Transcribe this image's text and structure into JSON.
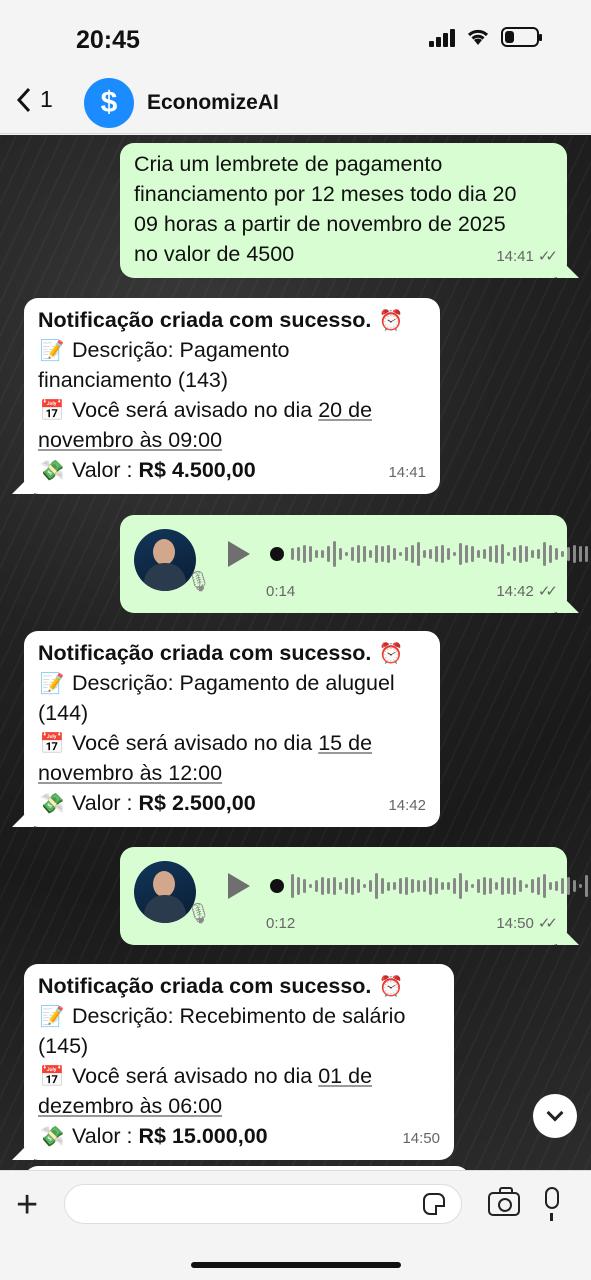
{
  "status_bar": {
    "time": "20:45"
  },
  "header": {
    "back_count": "1",
    "contact_name": "EconomizeAI",
    "avatar_symbol": "$"
  },
  "messages": [
    {
      "type": "outgoing_text",
      "lines": [
        "Cria um lembrete de pagamento",
        "financiamento por 12 meses todo dia 20",
        "09 horas a partir de novembro de 2025",
        "no valor de 4500"
      ],
      "time": "14:41"
    },
    {
      "type": "incoming_notification",
      "title": "Notificação criada com sucesso.",
      "desc_label": "Descrição: ",
      "desc_value": "Pagamento financiamento (143)",
      "date_prefix": "Você será avisado no dia ",
      "date_value": "20 de novembro às 09:00",
      "value_label": "Valor : ",
      "value_amount": "R$ 4.500,00",
      "time": "14:41"
    },
    {
      "type": "outgoing_voice",
      "duration": "0:14",
      "time": "14:42"
    },
    {
      "type": "incoming_notification",
      "title": "Notificação criada com sucesso.",
      "desc_label": "Descrição: ",
      "desc_value": "Pagamento de aluguel (144)",
      "date_prefix": "Você será avisado no dia ",
      "date_value": "15 de novembro às 12:00",
      "value_label": "Valor : ",
      "value_amount": "R$ 2.500,00",
      "time": "14:42"
    },
    {
      "type": "outgoing_voice",
      "duration": "0:12",
      "time": "14:50"
    },
    {
      "type": "incoming_notification",
      "title": "Notificação criada com sucesso.",
      "desc_label": "Descrição: ",
      "desc_value": "Recebimento de salário (145)",
      "date_prefix": "Você será avisado no dia ",
      "date_value": "01 de dezembro às 06:00",
      "value_label": "Valor : ",
      "value_amount": "R$ 15.000,00",
      "time": "14:50"
    }
  ],
  "icons": {
    "alarm": "alarm-clock-icon",
    "memo": "memo-icon",
    "calendar": "calendar-icon",
    "money": "money-with-wings-icon"
  },
  "colors": {
    "outgoing_bubble": "#d9fdd3",
    "incoming_bubble": "#ffffff",
    "avatar_blue": "#1a8cff"
  }
}
